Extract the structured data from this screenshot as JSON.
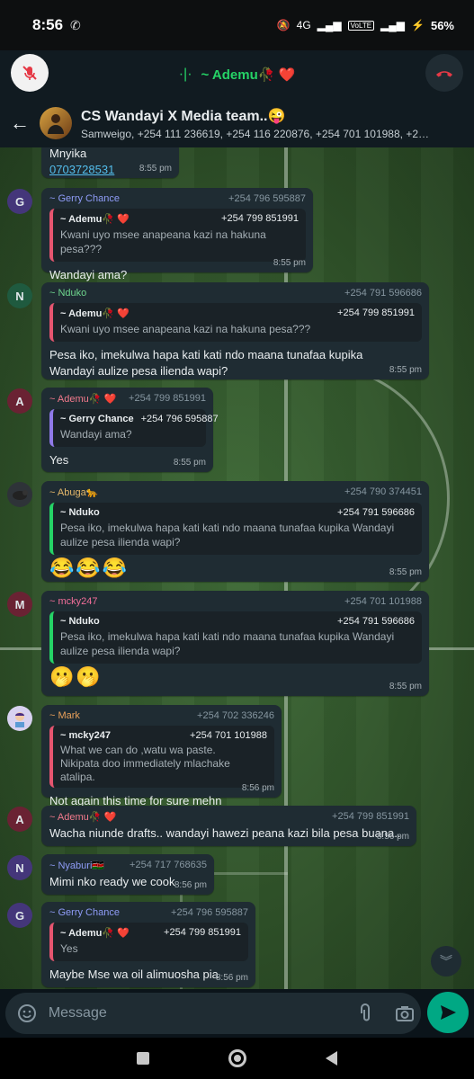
{
  "status_bar": {
    "time": "8:56",
    "battery": "56%",
    "network": "4G",
    "volte": "VoLTE"
  },
  "call_bar": {
    "name": "~ Ademu🥀 ❤️"
  },
  "header": {
    "title": "CS Wandayi X Media team..😜",
    "participants": "Samweigo, +254 111 236619, +254 116 220876, +254 701 101988, +254 ..."
  },
  "messages": [
    {
      "text": "Mnyika",
      "link": "0703728531",
      "time": "8:55 pm"
    },
    {
      "avatar": "G",
      "sender": "~ Gerry Chance",
      "phone": "+254 796 595887",
      "quote_sender": "~ Ademu🥀 ❤️",
      "quote_phone": "+254 799 851991",
      "quote_text": "Kwani uyo msee anapeana kazi na hakuna pesa???",
      "text": "Wandayi ama?",
      "time": "8:55 pm"
    },
    {
      "avatar": "N",
      "sender": "~ Nduko",
      "phone": "+254 791 596686",
      "quote_sender": "~ Ademu🥀 ❤️",
      "quote_phone": "+254 799 851991",
      "quote_text": "Kwani uyo msee anapeana kazi na hakuna pesa???",
      "text": "Pesa iko, imekulwa hapa kati kati ndo maana tunafaa kupika Wandayi aulize pesa ilienda wapi?",
      "time": "8:55 pm"
    },
    {
      "avatar": "A",
      "sender": "~ Ademu🥀 ❤️",
      "phone": "+254 799 851991",
      "quote_sender": "~ Gerry Chance",
      "quote_phone": "+254 796 595887",
      "quote_text": "Wandayi ama?",
      "text": "Yes",
      "time": "8:55 pm"
    },
    {
      "sender": "~ Abuga🐆",
      "phone": "+254 790 374451",
      "quote_sender": "~ Nduko",
      "quote_phone": "+254 791 596686",
      "quote_text": "Pesa iko, imekulwa hapa kati kati ndo maana tunafaa kupika Wandayi aulize pesa ilienda wapi?",
      "text": "😂😂😂",
      "time": "8:55 pm"
    },
    {
      "avatar": "M",
      "sender": "~ mcky247",
      "phone": "+254 701 101988",
      "quote_sender": "~ Nduko",
      "quote_phone": "+254 791 596686",
      "quote_text": "Pesa iko, imekulwa hapa kati kati ndo maana tunafaa kupika Wandayi aulize pesa ilienda wapi?",
      "text": "🫢🫢",
      "time": "8:55 pm"
    },
    {
      "sender": "~ Mark",
      "phone": "+254 702 336246",
      "quote_sender": "~ mcky247",
      "quote_phone": "+254 701 101988",
      "quote_text": "What we can do ,watu wa paste.\nNikipata doo immediately mlachake atalipa.",
      "text": "Not again this time for sure mehn",
      "time": "8:56 pm"
    },
    {
      "avatar": "A",
      "sender": "~ Ademu🥀 ❤️",
      "phone": "+254 799 851991",
      "text": "Wacha niunde drafts.. wandayi hawezi peana kazi bila pesa buana..",
      "time": "8:56 pm"
    },
    {
      "avatar": "N",
      "sender": "~ Nyaburi🇰🇪",
      "phone": "+254 717 768635",
      "text": "Mimi nko ready we cook",
      "time": "8:56 pm"
    },
    {
      "avatar": "G",
      "sender": "~ Gerry Chance",
      "phone": "+254 796 595887",
      "quote_sender": "~ Ademu🥀 ❤️",
      "quote_phone": "+254 799 851991",
      "quote_text": "Yes",
      "text": "Maybe Mse wa oil alimuosha pia",
      "time": "8:56 pm"
    }
  ],
  "composer": {
    "placeholder": "Message"
  },
  "colors": {
    "accent": "#00a884",
    "call_green": "#25d366",
    "bubble": "#1f2c33",
    "quote_bar_pink": "#e6556f",
    "quote_bar_purple": "#8f79e8",
    "quote_bar_green": "#25d366"
  },
  "icons": [
    "phone-icon",
    "mute-mic-icon",
    "end-call-icon",
    "back-arrow-icon",
    "sticker-icon",
    "attach-icon",
    "camera-icon",
    "send-icon",
    "scroll-down-icon",
    "nav-square-icon",
    "nav-home-icon",
    "nav-back-icon"
  ]
}
